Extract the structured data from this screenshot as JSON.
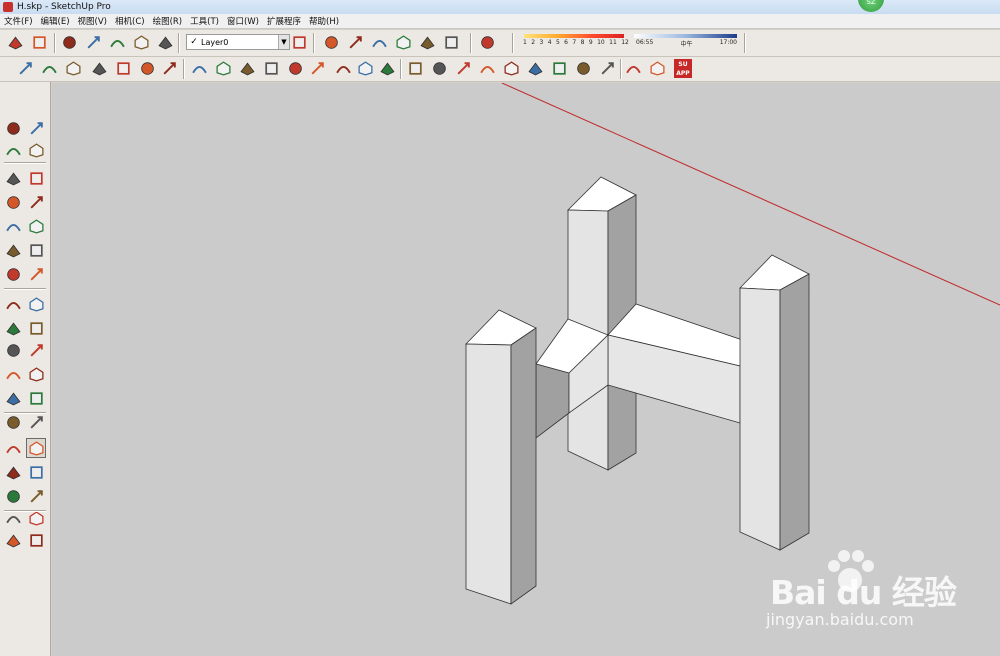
{
  "window": {
    "title": "H.skp - SketchUp Pro",
    "user_badge": "SZ"
  },
  "menu": [
    {
      "label": "文件(F)"
    },
    {
      "label": "编辑(E)"
    },
    {
      "label": "视图(V)"
    },
    {
      "label": "相机(C)"
    },
    {
      "label": "绘图(R)"
    },
    {
      "label": "工具(T)"
    },
    {
      "label": "窗口(W)"
    },
    {
      "label": "扩展程序"
    },
    {
      "label": "帮助(H)"
    }
  ],
  "layers": {
    "current": "Layer0",
    "checked": "✓"
  },
  "shadows": {
    "months": [
      "1",
      "2",
      "3",
      "4",
      "5",
      "6",
      "7",
      "8",
      "9",
      "10",
      "11",
      "12"
    ],
    "time_start": "06:55",
    "time_mid": "中午",
    "time_end": "17:00"
  },
  "toolbar_row1_icons": [
    "open-icon",
    "save-icon",
    "component-icon",
    "material-icon",
    "warehouse-icon",
    "share-icon",
    "extension-icon",
    "iso-view-icon",
    "top-view-icon",
    "front-view-icon",
    "right-view-icon",
    "back-view-icon",
    "left-view-icon",
    "xray-icon",
    "back-edges-icon"
  ],
  "toolbar_row2_icons": [
    "section-plane-icon",
    "section-fill-icon",
    "camera-icon",
    "follow-me-icon",
    "push-pull-icon",
    "offset-icon",
    "rotate-icon",
    "scale-icon",
    "move-icon",
    "arc-icon",
    "rectangle-icon",
    "polygon-icon",
    "freehand-icon",
    "tape-icon",
    "dimension-icon",
    "protractor-icon",
    "text-icon",
    "axes-icon",
    "3d-text-icon",
    "paint-icon",
    "sandbox-icon",
    "component-box-icon",
    "measure-icon",
    "compass-icon",
    "walk-icon",
    "3d-warehouse-icon",
    "style-icon",
    "su-app-icon"
  ],
  "left_toolbar_icons": [
    "select-icon",
    "component-icon",
    "paint-bucket-icon",
    "eraser-icon",
    "line-icon",
    "freehand-icon",
    "rectangle-icon",
    "rotated-rectangle-icon",
    "circle-icon",
    "polygon-icon",
    "arc-icon",
    "two-point-arc-icon",
    "three-point-arc-icon",
    "pie-icon",
    "move-icon",
    "push-pull-icon",
    "rotate-icon",
    "follow-me-icon",
    "scale-icon",
    "offset-icon",
    "tape-measure-icon",
    "dimension-icon",
    "protractor-icon",
    "text-icon",
    "axes-icon",
    "3d-text-icon",
    "orbit-icon",
    "pan-icon",
    "zoom-icon",
    "zoom-window-icon",
    "zoom-extents-icon",
    "previous-view-icon",
    "position-camera-icon",
    "look-around-icon",
    "walk-icon",
    "section-plane-icon"
  ],
  "su_app_label": "SU APP",
  "watermark": {
    "brand": "Bai du 经验",
    "site": "jingyan.baidu.com"
  },
  "colors": {
    "viewport_bg": "#cbcbcb",
    "face_top": "#ffffff",
    "face_light": "#e2e2e2",
    "face_dark": "#9c9c9c",
    "axis_red": "#c0282a"
  }
}
